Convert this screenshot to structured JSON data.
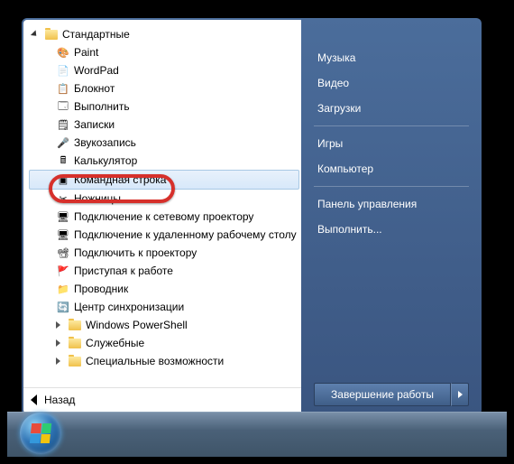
{
  "tree": {
    "root": "Стандартные",
    "items": [
      {
        "label": "Paint",
        "icon": "🎨"
      },
      {
        "label": "WordPad",
        "icon": "📄"
      },
      {
        "label": "Блокнот",
        "icon": "📋"
      },
      {
        "label": "Выполнить",
        "icon": "🗔"
      },
      {
        "label": "Записки",
        "icon": "🗒"
      },
      {
        "label": "Звукозапись",
        "icon": "🎤"
      },
      {
        "label": "Калькулятор",
        "icon": "🖩"
      },
      {
        "label": "Командная строка",
        "icon": "▣",
        "selected": true
      },
      {
        "label": "Ножницы",
        "icon": "✂"
      },
      {
        "label": "Подключение к сетевому проектору",
        "icon": "🖥"
      },
      {
        "label": "Подключение к удаленному рабочему столу",
        "icon": "🖥"
      },
      {
        "label": "Подключить к проектору",
        "icon": "📽"
      },
      {
        "label": "Приступая к работе",
        "icon": "🚩"
      },
      {
        "label": "Проводник",
        "icon": "📁"
      },
      {
        "label": "Центр синхронизации",
        "icon": "🔄"
      }
    ],
    "subfolders": [
      "Windows PowerShell",
      "Служебные",
      "Специальные возможности"
    ]
  },
  "back": "Назад",
  "right": {
    "links1": [
      "Музыка",
      "Видео",
      "Загрузки"
    ],
    "links2": [
      "Игры",
      "Компьютер"
    ],
    "links3": [
      "Панель управления",
      "Выполнить..."
    ]
  },
  "shutdown": "Завершение работы"
}
